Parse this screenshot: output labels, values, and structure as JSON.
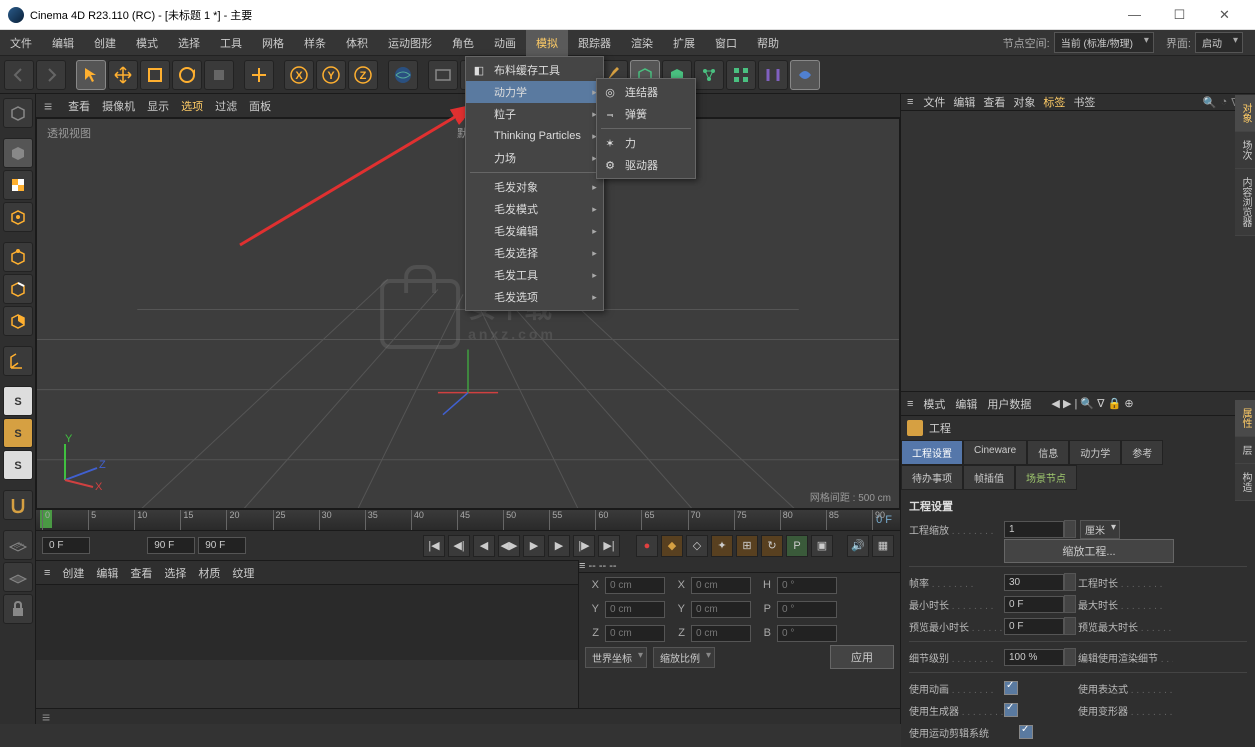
{
  "window": {
    "title": "Cinema 4D R23.110 (RC) - [未标题 1 *] - 主要"
  },
  "menubar": {
    "items": [
      "文件",
      "编辑",
      "创建",
      "模式",
      "选择",
      "工具",
      "网格",
      "样条",
      "体积",
      "运动图形",
      "角色",
      "动画",
      "模拟",
      "跟踪器",
      "渲染",
      "扩展",
      "窗口",
      "帮助"
    ],
    "active_index": 12,
    "node_space_label": "节点空间:",
    "node_space_value": "当前 (标准/物理)",
    "layout_label": "界面:",
    "layout_value": "启动"
  },
  "popup_main": {
    "items": [
      {
        "label": "布料缓存工具",
        "icon": "◧"
      },
      {
        "label": "动力学",
        "sub": true,
        "hl": true
      },
      {
        "label": "粒子",
        "sub": true
      },
      {
        "label": "Thinking Particles",
        "sub": true
      },
      {
        "label": "力场",
        "sub": true
      },
      {
        "sep": true
      },
      {
        "label": "毛发对象",
        "sub": true
      },
      {
        "label": "毛发模式",
        "sub": true
      },
      {
        "label": "毛发编辑",
        "sub": true
      },
      {
        "label": "毛发选择",
        "sub": true
      },
      {
        "label": "毛发工具",
        "sub": true
      },
      {
        "label": "毛发选项",
        "sub": true
      }
    ]
  },
  "popup_sub": {
    "items": [
      {
        "label": "连结器",
        "icon": "◎"
      },
      {
        "label": "弹簧",
        "icon": "⫬"
      },
      {
        "sep": true
      },
      {
        "label": "力",
        "icon": "✶"
      },
      {
        "label": "驱动器",
        "icon": "⚙"
      }
    ]
  },
  "viewport": {
    "menus": [
      "查看",
      "摄像机",
      "显示",
      "选项",
      "过滤",
      "面板"
    ],
    "hl_index": 3,
    "label": "透视视图",
    "center_label": "默认",
    "grid_info": "网格间距 : 500 cm"
  },
  "timeline": {
    "ticks": [
      "0",
      "5",
      "10",
      "15",
      "20",
      "25",
      "30",
      "35",
      "40",
      "45",
      "50",
      "55",
      "60",
      "65",
      "70",
      "75",
      "80",
      "85",
      "90"
    ],
    "current": "0 F",
    "range_start": "0 F",
    "range_end": "90 F",
    "loop_end": "90 F"
  },
  "material_menu": [
    "创建",
    "编辑",
    "查看",
    "选择",
    "材质",
    "纹理"
  ],
  "coord": {
    "x": "0 cm",
    "y": "0 cm",
    "z": "0 cm",
    "sx": "0 cm",
    "sy": "0 cm",
    "sz": "0 cm",
    "h": "0 °",
    "p": "0 °",
    "b": "0 °",
    "space": "世界坐标",
    "scale_mode": "缩放比例",
    "apply": "应用",
    "dash": "--"
  },
  "objects_panel": {
    "menus": [
      "文件",
      "编辑",
      "查看",
      "对象",
      "标签",
      "书签"
    ],
    "hl_index": 4
  },
  "right_tabs": [
    "对象",
    "场次",
    "内容浏览器"
  ],
  "right_tabs2": [
    "属性",
    "层",
    "构造"
  ],
  "attr": {
    "menus": [
      "模式",
      "编辑",
      "用户数据"
    ],
    "title": "工程",
    "tabs1": [
      "工程设置",
      "Cineware",
      "信息",
      "动力学",
      "参考"
    ],
    "tabs2": [
      "待办事项",
      "帧插值",
      "场景节点"
    ],
    "section": "工程设置",
    "scale_label": "工程缩放",
    "scale_val": "1",
    "scale_unit": "厘米",
    "scale_btn": "缩放工程...",
    "fps_label": "帧率",
    "fps_val": "30",
    "proj_len_label": "工程时长",
    "min_label": "最小时长",
    "min_val": "0 F",
    "max_label": "最大时长",
    "prev_min_label": "预览最小时长",
    "prev_min_val": "0 F",
    "prev_max_label": "预览最大时长",
    "lod_label": "细节级别",
    "lod_val": "100 %",
    "lod_edit_label": "编辑使用渲染细节",
    "use_anim": "使用动画",
    "use_expr": "使用表达式",
    "use_gen": "使用生成器",
    "use_def": "使用变形器",
    "use_motion": "使用运动剪辑系统"
  }
}
